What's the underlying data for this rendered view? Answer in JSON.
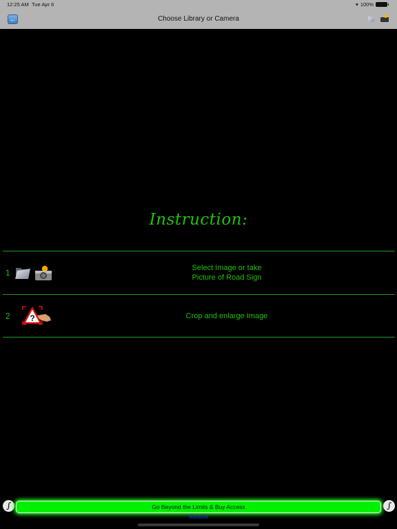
{
  "status_bar": {
    "time": "12:25 AM",
    "date": "Tue Apr 6",
    "battery": "100%",
    "wifi_icon": "wifi-icon"
  },
  "nav": {
    "title": "Choose Library or Camera",
    "back_icon": "back-arrow-icon",
    "library_icon": "photo-library-icon",
    "camera_icon": "camera-icon"
  },
  "instruction": {
    "title": "Instruction:",
    "steps": [
      {
        "number": "1",
        "icons": [
          "folder-icon",
          "camera-flash-icon"
        ],
        "text_line1": "Select Image or take",
        "text_line2": "Picture of Road Sign"
      },
      {
        "number": "2",
        "icons": [
          "crop-road-sign-icon"
        ],
        "text_line1": "Crop and enlarge Image",
        "text_line2": ""
      }
    ]
  },
  "footer": {
    "buy_label": "Go Beyond the Limits & Buy Access",
    "restore_label": "Restore",
    "left_badge_icon": "app-logo-icon",
    "right_badge_icon": "app-logo-icon",
    "buy_color": "#00f000",
    "restore_color": "#1a3be8"
  },
  "colors": {
    "accent_green": "#22c10e",
    "divider_green": "#1f9e1f",
    "topbar_gray": "#b4b4b4"
  }
}
